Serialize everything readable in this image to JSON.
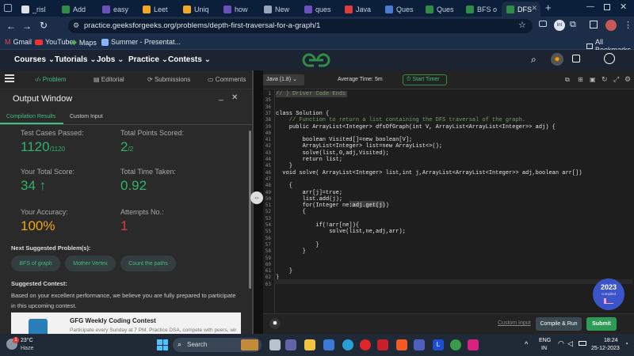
{
  "browser": {
    "tabs": [
      {
        "label": "_risl",
        "color": "#e0e0e0"
      },
      {
        "label": "Add",
        "color": "#2f8d46"
      },
      {
        "label": "easy",
        "color": "#6b4fbb"
      },
      {
        "label": "Leet",
        "color": "#f5a623"
      },
      {
        "label": "Uniq",
        "color": "#f5a623"
      },
      {
        "label": "how",
        "color": "#6b4fbb"
      },
      {
        "label": "New",
        "color": "#9aa6b8"
      },
      {
        "label": "ques",
        "color": "#6b4fbb"
      },
      {
        "label": "Java",
        "color": "#e03a3a"
      },
      {
        "label": "Ques",
        "color": "#4a7bd0"
      },
      {
        "label": "Ques",
        "color": "#2f8d46"
      },
      {
        "label": "BFS o",
        "color": "#2f8d46"
      },
      {
        "label": "DFS",
        "color": "#2f8d46"
      }
    ],
    "url": "practice.geeksforgeeks.org/problems/depth-first-traversal-for-a-graph/1",
    "bookmarks": [
      "Gmail",
      "YouTube",
      "Maps",
      "Summer - Presentat..."
    ],
    "all_bookmarks": "All Bookmarks"
  },
  "gfg_nav": {
    "items": [
      "Courses",
      "Tutorials",
      "Jobs",
      "Practice",
      "Contests"
    ]
  },
  "left": {
    "tabs": [
      "Problem",
      "Editorial",
      "Submissions",
      "Comments"
    ],
    "output_title": "Output Window",
    "subtabs": [
      "Compilation Results",
      "Custom Input"
    ],
    "test_cases_label": "Test Cases Passed:",
    "test_cases_value": "1120",
    "test_cases_total": "/1120",
    "points_label": "Total Points Scored:",
    "points_value": "2",
    "points_total": "/2",
    "score_label": "Your Total Score:",
    "score_value": "34",
    "time_label": "Total Time Taken:",
    "time_value": "0.92",
    "accuracy_label": "Your Accuracy:",
    "accuracy_value": "100%",
    "attempts_label": "Attempts No.:",
    "attempts_value": "1",
    "next_label": "Next Suggested Problem(s):",
    "next_problems": [
      "BFS of graph",
      "Mother Vertex",
      "Count the paths"
    ],
    "contest_label": "Suggested Contest:",
    "contest_text": "Based on your excellent performance, we believe you are fully prepared to participate in this upcoming contest.",
    "contest_title": "GFG Weekly Coding Contest",
    "contest_desc": "Participate every Sunday at 7 PM. Practice DSA, compete with peers, win"
  },
  "editor": {
    "language": "Java (1.8)",
    "avg_time": "Average Time: 5m",
    "start_timer": "Start Timer",
    "lines": [
      {
        "n": "1",
        "code": "// } Driver Code Ends",
        "c": "#7a9a6a"
      },
      {
        "n": "35",
        "code": "",
        "c": "#e8e8e8"
      },
      {
        "n": "36",
        "code": "",
        "c": "#e8e8e8"
      },
      {
        "n": "37",
        "code": "class Solution {",
        "c": "#e8e8e8"
      },
      {
        "n": "38",
        "code": "    // Function to return a list containing the DFS traversal of the graph.",
        "c": "#7a9a6a"
      },
      {
        "n": "39",
        "code": "    public ArrayList<Integer> dfsOfGraph(int V, ArrayList<ArrayList<Integer>> adj) {",
        "c": "#e8e8e8"
      },
      {
        "n": "40",
        "code": "",
        "c": "#e8e8e8"
      },
      {
        "n": "41",
        "code": "        boolean Visited[]=new boolean[V];",
        "c": "#e8e8e8"
      },
      {
        "n": "42",
        "code": "        ArrayList<Integer> list=new ArrayList<>();",
        "c": "#e8e8e8"
      },
      {
        "n": "43",
        "code": "        solve(list,0,adj,Visited);",
        "c": "#e8e8e8"
      },
      {
        "n": "44",
        "code": "        return list;",
        "c": "#e8e8e8"
      },
      {
        "n": "45",
        "code": "    }",
        "c": "#e8e8e8"
      },
      {
        "n": "46",
        "code": "  void solve( ArrayList<Integer> list,int j,ArrayList<ArrayList<Integer>> adj,boolean arr[])",
        "c": "#e8e8e8"
      },
      {
        "n": "47",
        "code": "",
        "c": "#e8e8e8"
      },
      {
        "n": "48",
        "code": "    {",
        "c": "#e8e8e8"
      },
      {
        "n": "49",
        "code": "        arr[j]=true;",
        "c": "#e8e8e8"
      },
      {
        "n": "50",
        "code": "        list.add(j);",
        "c": "#e8e8e8"
      },
      {
        "n": "51",
        "code": "        for(Integer ne:adj.get(j))",
        "c": "#e8e8e8"
      },
      {
        "n": "52",
        "code": "        {",
        "c": "#e8e8e8"
      },
      {
        "n": "53",
        "code": "",
        "c": "#e8e8e8"
      },
      {
        "n": "54",
        "code": "            if(!arr[ne]){",
        "c": "#e8e8e8"
      },
      {
        "n": "55",
        "code": "                solve(list,ne,adj,arr);",
        "c": "#e8e8e8"
      },
      {
        "n": "56",
        "code": "",
        "c": "#e8e8e8"
      },
      {
        "n": "57",
        "code": "            }",
        "c": "#e8e8e8"
      },
      {
        "n": "58",
        "code": "        }",
        "c": "#e8e8e8"
      },
      {
        "n": "59",
        "code": "",
        "c": "#e8e8e8"
      },
      {
        "n": "60",
        "code": "",
        "c": "#e8e8e8"
      },
      {
        "n": "61",
        "code": "    }",
        "c": "#e8e8e8"
      },
      {
        "n": "62",
        "code": "}",
        "c": "#e8e8e8"
      },
      {
        "n": "63",
        "code": "",
        "c": "#e8e8e8"
      }
    ],
    "custom_input": "Custom Input",
    "compile_run": "Compile & Run",
    "submit": "Submit",
    "badge_year": "2023",
    "badge_text": "compiled"
  },
  "taskbar": {
    "weather_temp": "23°C",
    "weather_desc": "Haze",
    "search": "Search",
    "lang": "ENG",
    "region": "IN",
    "time": "18:24",
    "date": "25-12-2023",
    "notif": "1"
  },
  "colors": {
    "accent_green": "#2f8d46",
    "value_green": "#2fb36b",
    "attempts_red": "#e23b3b",
    "submit_green": "#2e9b54"
  }
}
